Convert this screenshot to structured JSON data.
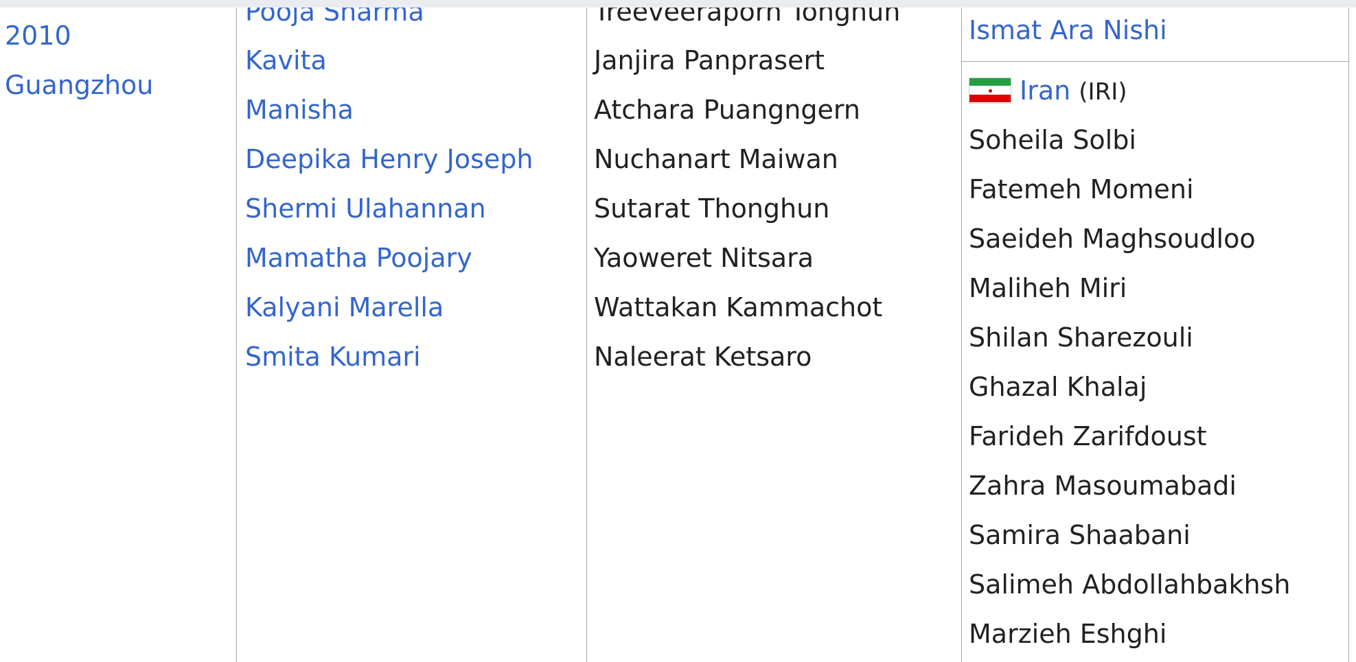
{
  "year_cell": {
    "year": "2010",
    "city": "Guangzhou"
  },
  "gold": {
    "athletes": [
      "Pooja Sharma",
      "Kavita",
      "Manisha",
      "Deepika Henry Joseph",
      "Shermi Ulahannan",
      "Mamatha Poojary",
      "Kalyani Marella",
      "Smita Kumari"
    ]
  },
  "silver": {
    "athletes": [
      "Treeveeraporn Tonghun",
      "Janjira Panprasert",
      "Atchara Puangngern",
      "Nuchanart Maiwan",
      "Sutarat Thonghun",
      "Yaoweret Nitsara",
      "Wattakan Kammachot",
      "Naleerat Ketsaro"
    ]
  },
  "bronze": {
    "prev_team_last_athlete": "Ismat Ara Nishi",
    "team": {
      "flag_icon": "iran-flag-icon",
      "country": "Iran",
      "code": "(IRI)",
      "athletes": [
        "Soheila Solbi",
        "Fatemeh Momeni",
        "Saeideh Maghsoudloo",
        "Maliheh Miri",
        "Shilan Sharezouli",
        "Ghazal Khalaj",
        "Farideh Zarifdoust",
        "Zahra Masoumabadi",
        "Samira Shaabani",
        "Salimeh Abdollahbakhsh",
        "Marzieh Eshghi"
      ]
    }
  },
  "colors": {
    "link": "#3366cc",
    "text": "#202122",
    "border": "#a2a9b1"
  }
}
